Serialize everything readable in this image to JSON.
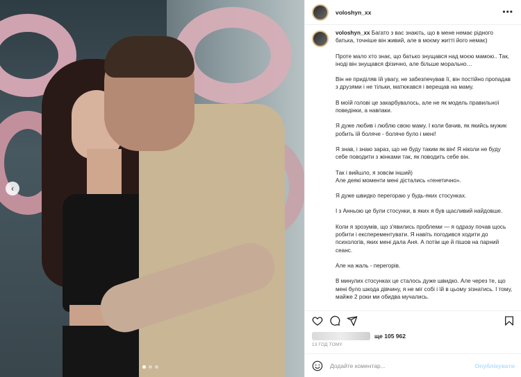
{
  "post": {
    "username": "voloshyn_xx",
    "more_label": "•••"
  },
  "caption": {
    "username": "voloshyn_xx",
    "lead": "Багато з вас знають, що в мене немає рідного батька, точніше він живий, але в моєму житті його немає)",
    "paragraphs": [
      "Проте мало хто знає, що батько знущався над моєю мамою.. Так, іноді він знущався фізично, але більше морально…",
      "Він не приділяв їй увагу, не забезпечував її, він постійно пропадав з друзями і не тільки, матюкався і верещав на маму.",
      "В моїй голові це закарбувалось, але не як модель правильної поведінки, а навпаки.",
      "Я дуже любив і люблю свою маму. І коли бачив, як якийсь мужик робить їй боляче - боляче було і мені!",
      "Я знав, і знаю зараз, що не буду таким як він! Я ніколи не буду себе поводити з жінками так, як поводить себе він.",
      "Так і вийшло, я зовсім інший)\nАле деякі моменти мені дістались «генетично».",
      "Я дуже швидко перегораю у будь-яких стосунках.",
      "І з Анньою це були стосунки, в яких я був щасливий найдовше.",
      "Коли я зрозумів, що з'явились проблеми — я одразу почав щось робити і експерементувати. Я навіть погодився ходити до психологів, яких мені дала Аня. А потім ще й пішов на парний сеанс.",
      "Але на жаль - перегорів.",
      "В минулих стосунках це сталось дуже швидко. Але через те, що мені було шкода дівчину, я не міг собі і їй в цьому зізнатись. І тому, майже 2 роки ми обидва мучались."
    ]
  },
  "likes": {
    "count_text": "ще 105 962"
  },
  "timestamp": "13 ГОД ТОМУ",
  "comment": {
    "placeholder": "Додайте коментар...",
    "publish_label": "Опублікувати"
  },
  "carousel": {
    "prev_glyph": "‹",
    "slide_count": 3,
    "active_slide": 1
  },
  "icons": {
    "like": "heart-icon",
    "comment": "comment-icon",
    "share": "share-icon",
    "save": "bookmark-icon",
    "emoji": "emoji-icon"
  },
  "colors": {
    "publish_disabled": "#b2dffc",
    "text": "#262626",
    "secondary": "#8e8e8e"
  }
}
